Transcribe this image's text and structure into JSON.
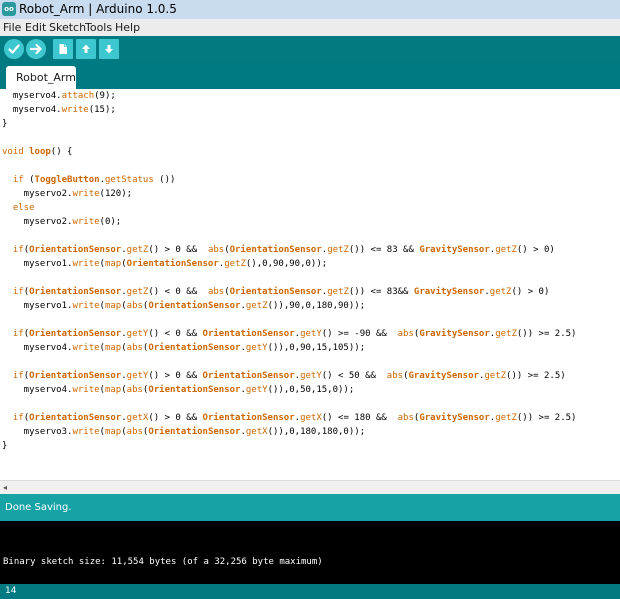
{
  "window": {
    "icon_text": "oo",
    "title": "Robot_Arm | Arduino 1.0.5"
  },
  "menu": [
    "File",
    "Edit",
    "Sketch",
    "Tools",
    "Help"
  ],
  "toolbar": {
    "buttons": [
      {
        "name": "verify",
        "icon": "checkmark-icon"
      },
      {
        "name": "upload",
        "icon": "arrow-right-icon"
      },
      {
        "name": "new",
        "icon": "new-file-icon"
      },
      {
        "name": "open",
        "icon": "arrow-up-icon"
      },
      {
        "name": "save",
        "icon": "arrow-down-icon"
      }
    ]
  },
  "tab": {
    "label": "Robot_Arm"
  },
  "code_lines": [
    "  myservo4.attach(9);",
    "  myservo4.write(15);",
    "}",
    "",
    "void loop() {",
    "",
    "  if (ToggleButton.getStatus ())",
    "    myservo2.write(120);",
    "  else",
    "    myservo2.write(0);",
    "",
    "  if(OrientationSensor.getZ() > 0 &&  abs(OrientationSensor.getZ()) <= 83 && GravitySensor.getZ() > 0)",
    "    myservo1.write(map(OrientationSensor.getZ(),0,90,90,0));",
    "",
    "  if(OrientationSensor.getZ() < 0 &&  abs(OrientationSensor.getZ()) <= 83&& GravitySensor.getZ() > 0)",
    "    myservo1.write(map(abs(OrientationSensor.getZ()),90,0,180,90));",
    "",
    "  if(OrientationSensor.getY() < 0 && OrientationSensor.getY() >= -90 &&  abs(GravitySensor.getZ()) >= 2.5)",
    "    myservo4.write(map(abs(OrientationSensor.getY()),0,90,15,105));",
    "",
    "  if(OrientationSensor.getY() > 0 && OrientationSensor.getY() < 50 &&  abs(GravitySensor.getZ()) >= 2.5)",
    "    myservo4.write(map(abs(OrientationSensor.getY()),0,50,15,0));",
    "",
    "  if(OrientationSensor.getX() > 0 && OrientationSensor.getX() <= 180 &&  abs(GravitySensor.getZ()) >= 2.5)",
    "    myservo3.write(map(abs(OrientationSensor.getX()),0,180,180,0));",
    "}"
  ],
  "scrollbar": {
    "left_arrow": "◂"
  },
  "status": {
    "message": "Done Saving."
  },
  "console": {
    "output": "Binary sketch size: 11,554 bytes (of a 32,256 byte maximum)"
  },
  "footer": {
    "line_number": "14"
  },
  "colors": {
    "toolbar_bg": "#017a82",
    "status_bg": "#17a2a6",
    "keyword": "#cc6600",
    "button_fill": "#3fc7cf"
  }
}
